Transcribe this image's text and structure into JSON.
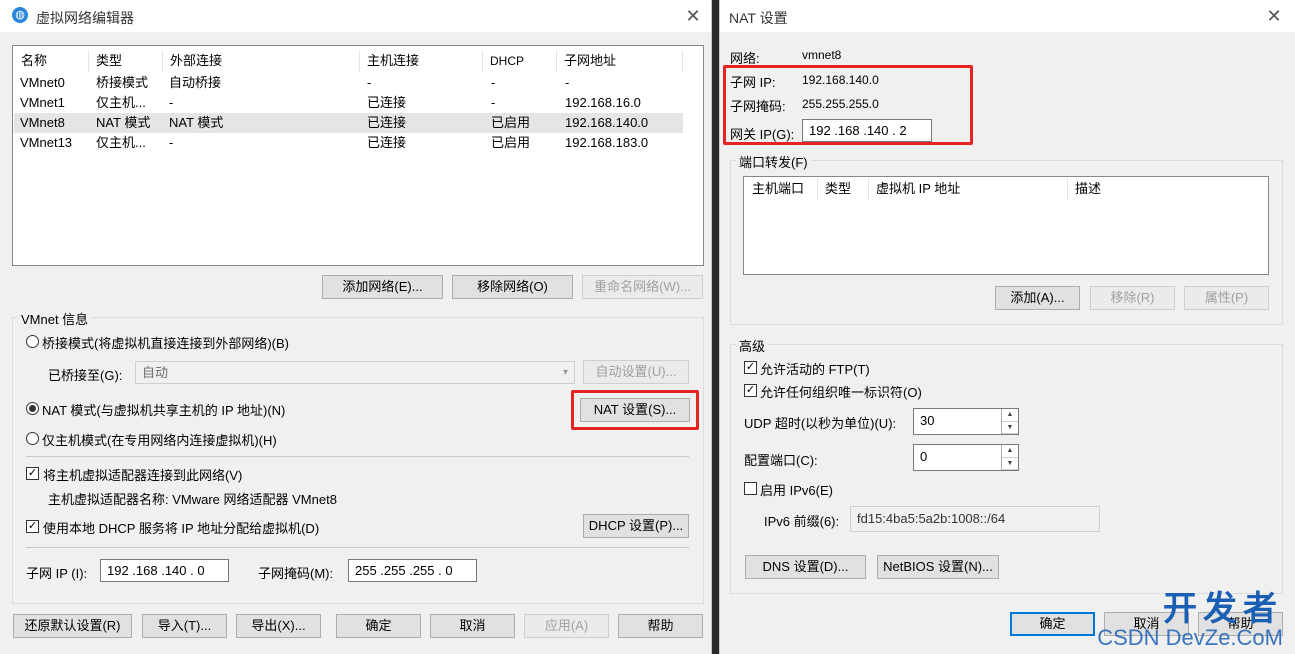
{
  "left": {
    "title": "虚拟网络编辑器",
    "table": {
      "headers": [
        "名称",
        "类型",
        "外部连接",
        "主机连接",
        "DHCP",
        "子网地址"
      ],
      "rows": [
        [
          "VMnet0",
          "桥接模式",
          "自动桥接",
          "-",
          "-",
          "-"
        ],
        [
          "VMnet1",
          "仅主机...",
          "-",
          "已连接",
          "-",
          "192.168.16.0"
        ],
        [
          "VMnet8",
          "NAT 模式",
          "NAT 模式",
          "已连接",
          "已启用",
          "192.168.140.0"
        ],
        [
          "VMnet13",
          "仅主机...",
          "-",
          "已连接",
          "已启用",
          "192.168.183.0"
        ]
      ]
    },
    "buttons": {
      "add_network": "添加网络(E)...",
      "remove_network": "移除网络(O)",
      "rename_network": "重命名网络(W)...",
      "auto_settings": "自动设置(U)...",
      "nat_settings": "NAT 设置(S)...",
      "dhcp_settings": "DHCP 设置(P)...",
      "restore_defaults": "还原默认设置(R)",
      "import": "导入(T)...",
      "export": "导出(X)...",
      "ok": "确定",
      "cancel": "取消",
      "apply": "应用(A)",
      "help": "帮助"
    },
    "vmnet_info": {
      "legend": "VMnet 信息",
      "bridge_mode": "桥接模式(将虚拟机直接连接到外部网络)(B)",
      "bridged_to_label": "已桥接至(G):",
      "bridged_to_value": "自动",
      "nat_mode": "NAT 模式(与虚拟机共享主机的 IP 地址)(N)",
      "host_only_mode": "仅主机模式(在专用网络内连接虚拟机)(H)",
      "connect_adapter": "将主机虚拟适配器连接到此网络(V)",
      "adapter_name": "主机虚拟适配器名称: VMware 网络适配器 VMnet8",
      "use_dhcp": "使用本地 DHCP 服务将 IP 地址分配给虚拟机(D)",
      "subnet_ip_label": "子网 IP (I):",
      "subnet_ip_value": "192 .168 .140 .  0",
      "subnet_mask_label": "子网掩码(M):",
      "subnet_mask_value": "255 .255 .255 .  0"
    }
  },
  "right": {
    "title": "NAT 设置",
    "network_label": "网络:",
    "network_value": "vmnet8",
    "subnet_ip_label": "子网 IP:",
    "subnet_ip_value": "192.168.140.0",
    "subnet_mask_label": "子网掩码:",
    "subnet_mask_value": "255.255.255.0",
    "gateway_label": "网关 IP(G):",
    "gateway_value": "192 .168 .140 .  2",
    "port_forwarding": {
      "legend": "端口转发(F)",
      "headers": [
        "主机端口",
        "类型",
        "虚拟机 IP 地址",
        "描述"
      ],
      "add": "添加(A)...",
      "remove": "移除(R)",
      "properties": "属性(P)"
    },
    "advanced": {
      "legend": "高级",
      "allow_ftp": "允许活动的 FTP(T)",
      "allow_oui": "允许任何组织唯一标识符(O)",
      "udp_timeout_label": "UDP 超时(以秒为单位)(U):",
      "udp_timeout_value": "30",
      "config_port_label": "配置端口(C):",
      "config_port_value": "0",
      "enable_ipv6": "启用 IPv6(E)",
      "ipv6_prefix_label": "IPv6 前缀(6):",
      "ipv6_prefix_value": "fd15:4ba5:5a2b:1008::/64"
    },
    "dns_settings": "DNS 设置(D)...",
    "netbios_settings": "NetBIOS 设置(N)...",
    "ok": "确定",
    "cancel": "取消",
    "help": "帮助"
  },
  "watermark": {
    "line1": "开发者",
    "line2": "CSDN DevZe.CoM"
  },
  "colors": {
    "highlight_red": "#e62222",
    "window_bg": "#f0f0f0",
    "selected_row": "#e5e5e5"
  }
}
